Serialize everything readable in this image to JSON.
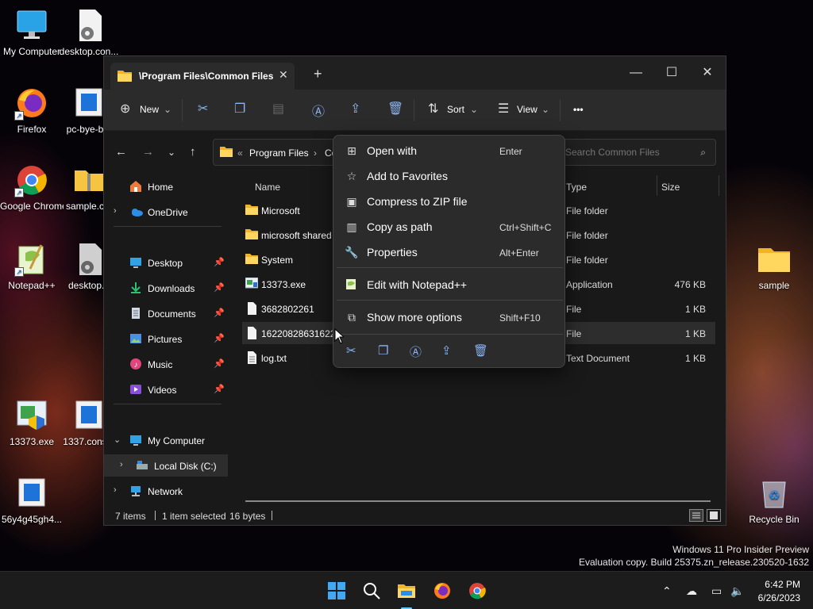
{
  "desktop": {
    "icons": [
      {
        "label": "My Computer",
        "icon": "monitor-icon"
      },
      {
        "label": "desktop.con...",
        "icon": "settings-file-icon"
      },
      {
        "label": "Firefox",
        "icon": "firefox-icon"
      },
      {
        "label": "pc-bye-b...",
        "icon": "app-window-icon"
      },
      {
        "label": "Google Chrome",
        "icon": "chrome-icon"
      },
      {
        "label": "sample.c...",
        "icon": "zip-folder-icon"
      },
      {
        "label": "Notepad++",
        "icon": "notepadpp-icon"
      },
      {
        "label": "desktop...",
        "icon": "settings-file-icon"
      },
      {
        "label": "13373.exe",
        "icon": "installer-icon"
      },
      {
        "label": "1337.cons...",
        "icon": "app-window-icon"
      },
      {
        "label": "56y4g45gh4...",
        "icon": "app-window-icon"
      },
      {
        "label": "sample",
        "icon": "folder-icon"
      },
      {
        "label": "Recycle Bin",
        "icon": "recycle-bin-icon"
      }
    ]
  },
  "window": {
    "tab_title": "\\Program Files\\Common Files",
    "new_tab": "+",
    "controls": {
      "minimize": "—",
      "maximize": "☐",
      "close": "✕"
    }
  },
  "toolbar": {
    "new_label": "New",
    "sort_label": "Sort",
    "view_label": "View",
    "more_label": "•••"
  },
  "address": {
    "overflow": "«",
    "crumb1": "Program Files",
    "crumb_sep": "›",
    "crumb2": "Co",
    "search_placeholder": "Search Common Files"
  },
  "nav": {
    "home": "Home",
    "onedrive": "OneDrive",
    "desktop": "Desktop",
    "downloads": "Downloads",
    "documents": "Documents",
    "pictures": "Pictures",
    "music": "Music",
    "videos": "Videos",
    "my_computer": "My Computer",
    "local_disk": "Local Disk (C:)",
    "network": "Network"
  },
  "files": {
    "columns": {
      "name": "Name",
      "type": "Type",
      "size": "Size"
    },
    "rows": [
      {
        "name": "Microsoft",
        "type": "File folder",
        "size": "",
        "icon": "folder-icon"
      },
      {
        "name": "microsoft shared",
        "type": "File folder",
        "size": "",
        "icon": "folder-icon"
      },
      {
        "name": "System",
        "type": "File folder",
        "size": "",
        "icon": "folder-icon"
      },
      {
        "name": "13373.exe",
        "type": "Application",
        "size": "476 KB",
        "icon": "exe-icon"
      },
      {
        "name": "3682802261",
        "type": "File",
        "size": "1 KB",
        "icon": "file-icon"
      },
      {
        "name": "162208286316220",
        "type": "File",
        "size": "1 KB",
        "icon": "file-icon"
      },
      {
        "name": "log.txt",
        "type": "Text Document",
        "size": "1 KB",
        "icon": "text-file-icon"
      }
    ]
  },
  "status": {
    "items": "7 items",
    "selected": "1 item selected",
    "bytes": "16 bytes"
  },
  "context_menu": {
    "items": [
      {
        "label": "Open with",
        "shortcut": "Enter",
        "icon": "open-with-icon"
      },
      {
        "label": "Add to Favorites",
        "shortcut": "",
        "icon": "star-icon"
      },
      {
        "label": "Compress to ZIP file",
        "shortcut": "",
        "icon": "zip-icon"
      },
      {
        "label": "Copy as path",
        "shortcut": "Ctrl+Shift+C",
        "icon": "copy-path-icon"
      },
      {
        "label": "Properties",
        "shortcut": "Alt+Enter",
        "icon": "wrench-icon"
      },
      {
        "label": "Edit with Notepad++",
        "shortcut": "",
        "icon": "notepadpp-icon"
      },
      {
        "label": "Show more options",
        "shortcut": "Shift+F10",
        "icon": "more-options-icon"
      }
    ]
  },
  "watermark": {
    "line1": "Windows 11 Pro Insider Preview",
    "line2": "Evaluation copy. Build 25375.zn_release.230520-1632"
  },
  "taskbar": {
    "time": "6:42 PM",
    "date": "6/26/2023"
  }
}
